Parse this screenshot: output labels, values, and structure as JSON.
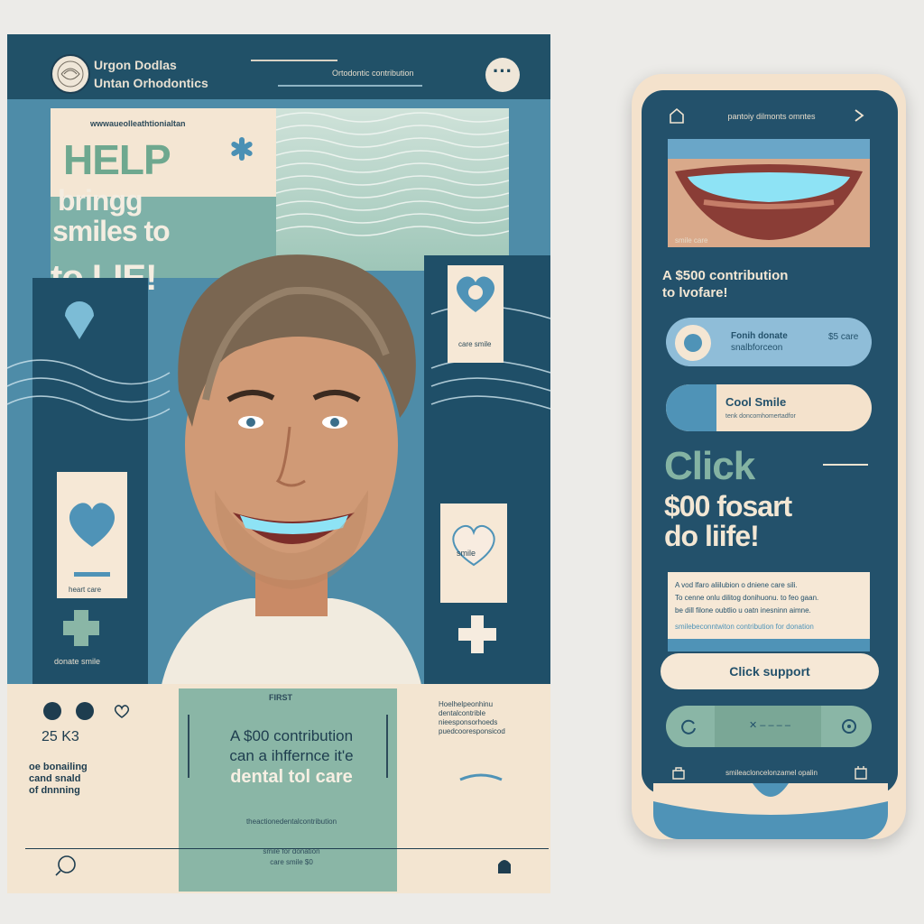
{
  "poster": {
    "logo_line1": "Urgon Dodlas",
    "logo_line2": "Untan Orhodontics",
    "header_small": "Ortodontic contribution",
    "tagline": "wwwaueolleathtionialtan",
    "help": "HELP",
    "line2": "bringg",
    "line3": "smiles to",
    "line4": "to LIE!",
    "heart_badge_label": "smile",
    "left_small_caption": "heart care",
    "right_small_caption": "care smile",
    "bottom_count": "25 K3",
    "bottom_left_text": "oe bonailing\ncand snald\nof dnnning",
    "bottom_left_small": "donate\nsmile",
    "first_label": "FIRST",
    "contribution_line1": "A $00 contribution",
    "contribution_line2": "can a ihffernce it'e",
    "contribution_line3": "dental tol care",
    "bottom_mid_url": "theactionedentalcontribution",
    "bottom_mid_footer": "smile for donation\ncare smile $0",
    "right_info_lines": "Hoelhelpeonhinu\ndentalcontrible\nnieesponsorhoeds\npuedcooresponsicod",
    "colors": {
      "dark": "#215168",
      "mid": "#4e8ca8",
      "cream": "#f4e6d3",
      "sage": "#87b7a8"
    }
  },
  "phone": {
    "header_title": "pantoiy dilmonts omntes",
    "smile_caption": "smile care",
    "headline": "A $500 contribution\nto lvofare!",
    "card1_line1": "Fonih donate",
    "card1_line2": "snalbforceon",
    "card1_right": "$5 care",
    "card2_label": "Cool Smile",
    "card2_sub": "tenk doncomhomertadfor",
    "click_big": "Click",
    "click_sub_line1": "$00 fosart",
    "click_sub_line2": "do liife!",
    "info_line1": "A vod lfaro aliilubion o dniene care sili.",
    "info_line2": "To cenne onlu dilitog donihuonu. to feo gaan.",
    "info_line3": "be dill filone oubtlio u oatn inesninn aimne.",
    "info_line4": "smilebeconntwiton contribution for donation",
    "support_button": "Click support",
    "nav_middle": "✕  – –  – –",
    "footer_text": "smileacloncelonzamel opalin",
    "icons": {
      "home": "home-icon",
      "back": "arrow-icon",
      "refresh": "refresh-icon",
      "bag": "bag-icon"
    }
  }
}
